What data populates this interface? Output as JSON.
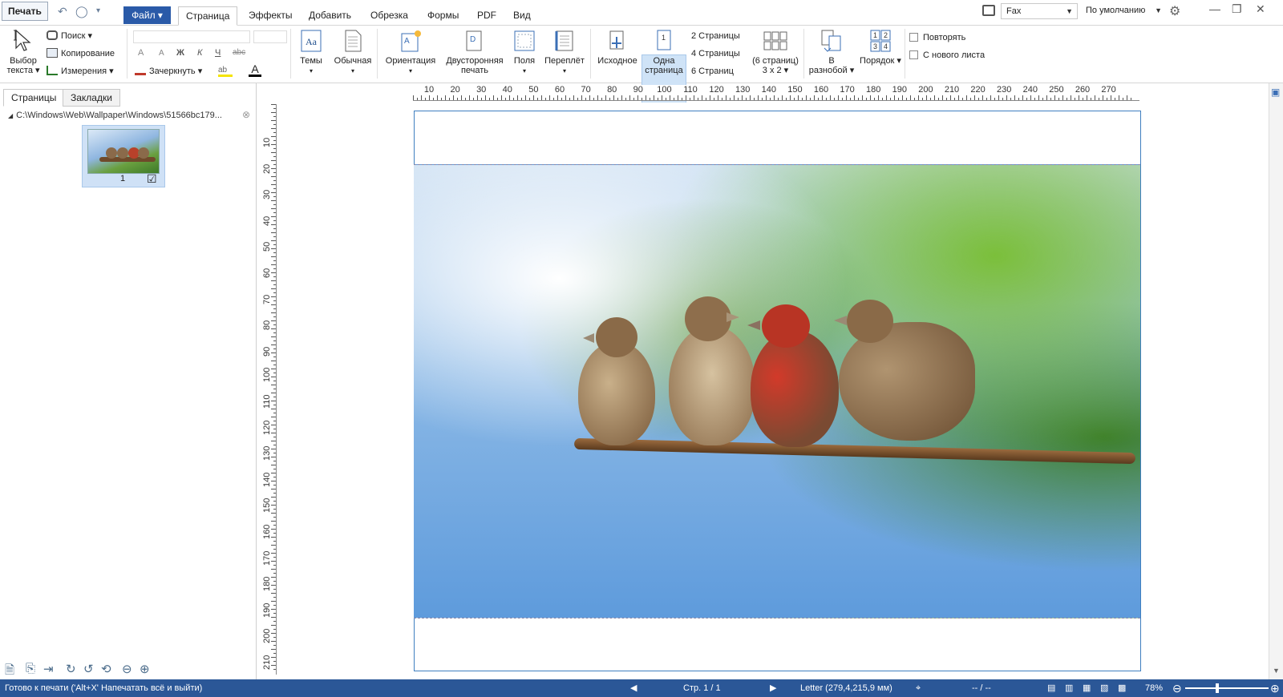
{
  "quick": {
    "print_label": "Печать",
    "undo_icon": "↶",
    "redo_icon": "◯",
    "qa_menu": "▾"
  },
  "menu": {
    "file": "Файл ▾",
    "tabs": [
      "Страница",
      "Эффекты",
      "Добавить",
      "Обрезка",
      "Формы",
      "PDF",
      "Вид"
    ]
  },
  "printer": {
    "name": "Fax",
    "preset": "По умолчанию"
  },
  "ribbon": {
    "select_text": [
      "Выбор",
      "текста ▾"
    ],
    "search": "Поиск ▾",
    "copy": "Копирование",
    "measure": "Измерения ▾",
    "strikeout": "Зачеркнуть ▾",
    "format_buttons": [
      "A",
      "A",
      "Ж",
      "К",
      "Ч",
      "abc"
    ],
    "themes": "Темы",
    "normal": "Обычная",
    "orientation": "Ориентация",
    "duplex": [
      "Двусторонняя",
      "печать"
    ],
    "margins": "Поля",
    "binding": "Переплёт",
    "original": "Исходное",
    "one_page": [
      "Одна",
      "страница"
    ],
    "pages2": "2 Страницы",
    "pages4": "4 Страницы",
    "pages6": "6 Страниц",
    "grid": [
      "(6 страниц)",
      "3 x 2 ▾"
    ],
    "spread": [
      "В",
      "разнобой ▾"
    ],
    "order": "Порядок ▾",
    "repeat": "Повторять",
    "new_sheet": "С нового листа"
  },
  "panel": {
    "tabs": [
      "Страницы",
      "Закладки"
    ],
    "path": "C:\\Windows\\Web\\Wallpaper\\Windows\\51566bc179...",
    "thumb_number": "1",
    "thumb_checked": "☑"
  },
  "ruler": {
    "h": [
      "10",
      "20",
      "30",
      "40",
      "50",
      "60",
      "70",
      "80",
      "90",
      "100",
      "110",
      "120",
      "130",
      "140",
      "150",
      "160",
      "170",
      "180",
      "190",
      "200",
      "210",
      "220",
      "230",
      "240",
      "250",
      "260",
      "270"
    ],
    "v": [
      "10",
      "20",
      "30",
      "40",
      "50",
      "60",
      "70",
      "80",
      "90",
      "100",
      "110",
      "120",
      "130",
      "140",
      "150",
      "160",
      "170",
      "180",
      "190",
      "200",
      "210"
    ]
  },
  "status": {
    "message": "Готово к печати ('Alt+X' Напечатать всё и выйти)",
    "page": "Стр. 1 / 1",
    "paper": "Letter (279,4,215,9 мм)",
    "coords": "-- / --",
    "zoom": "78%"
  }
}
